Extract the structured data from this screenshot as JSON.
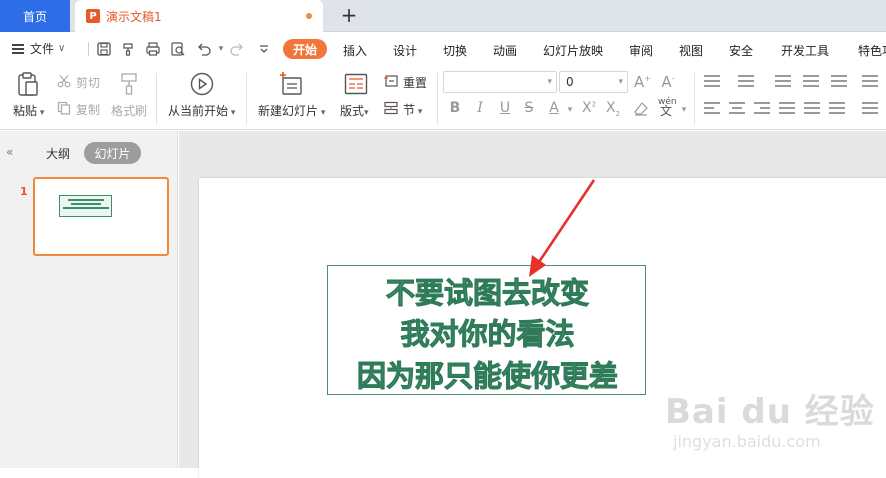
{
  "tabs": {
    "home": "首页",
    "doc_icon": "P",
    "doc_title": "演示文稿1",
    "new_tab": "+"
  },
  "menu": {
    "file": "文件",
    "file_caret": "∨",
    "quick_access": [
      "save-icon",
      "format-painter-icon",
      "print-icon",
      "print-preview-icon",
      "undo-icon",
      "redo-icon",
      "more-icon"
    ],
    "tabs": [
      "开始",
      "插入",
      "设计",
      "切换",
      "动画",
      "幻灯片放映",
      "审阅",
      "视图",
      "安全",
      "开发工具",
      "特色功能"
    ],
    "active_tab": "开始"
  },
  "ribbon": {
    "paste": "粘贴",
    "cut": "剪切",
    "copy": "复制",
    "format_painter": "格式刷",
    "from_current": "从当前开始",
    "new_slide": "新建幻灯片",
    "layout": "版式",
    "reset": "重置",
    "section": "节",
    "font_name": "",
    "font_size": "0",
    "phonetic": "wén"
  },
  "left_panel": {
    "tab_outline": "大纲",
    "tab_slides": "幻灯片",
    "slide_number": "1"
  },
  "slide": {
    "lines": [
      "不要试图去改变",
      "我对你的看法",
      "因为那只能使你更差"
    ]
  },
  "watermark": {
    "main": "Bai du 经验",
    "sub": "jingyan.baidu.com"
  },
  "colors": {
    "accent": "#f2763c",
    "home_tab": "#2d6ee8",
    "text_fill": "#5bb68c",
    "text_stroke": "#2f7a58",
    "arrow": "#e8312a"
  }
}
